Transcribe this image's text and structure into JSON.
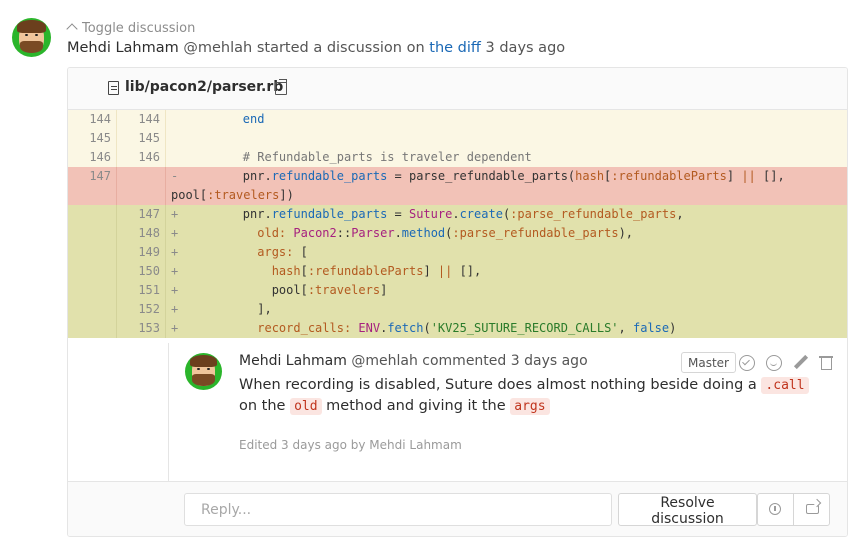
{
  "discussion": {
    "toggle_label": "Toggle discussion",
    "author_name": "Mehdi Lahmam",
    "author_handle": "@mehlah",
    "action_text": "started a discussion on",
    "diff_link": "the diff",
    "time_ago": "3 days ago"
  },
  "file": {
    "path": "lib/pacon2/parser.rb"
  },
  "diff_lines": [
    {
      "type": "ctx",
      "old": "144",
      "new": "144",
      "marker": "",
      "code": "        end"
    },
    {
      "type": "ctx",
      "old": "145",
      "new": "145",
      "marker": "",
      "code": ""
    },
    {
      "type": "ctx",
      "old": "146",
      "new": "146",
      "marker": "",
      "code": "        # Refundable_parts is traveler dependent"
    },
    {
      "type": "del",
      "old": "147",
      "new": "",
      "marker": "-",
      "code": "        pnr.refundable_parts = parse_refundable_parts(hash[:refundableParts] || [],\npool[:travelers])"
    },
    {
      "type": "add",
      "old": "",
      "new": "147",
      "marker": "+",
      "code": "        pnr.refundable_parts = Suture.create(:parse_refundable_parts,"
    },
    {
      "type": "add",
      "old": "",
      "new": "148",
      "marker": "+",
      "code": "          old: Pacon2::Parser.method(:parse_refundable_parts),"
    },
    {
      "type": "add",
      "old": "",
      "new": "149",
      "marker": "+",
      "code": "          args: ["
    },
    {
      "type": "add",
      "old": "",
      "new": "150",
      "marker": "+",
      "code": "            hash[:refundableParts] || [],"
    },
    {
      "type": "add",
      "old": "",
      "new": "151",
      "marker": "+",
      "code": "            pool[:travelers]"
    },
    {
      "type": "add",
      "old": "",
      "new": "152",
      "marker": "+",
      "code": "          ],"
    },
    {
      "type": "add",
      "old": "",
      "new": "153",
      "marker": "+",
      "code": "          record_calls: ENV.fetch('KV25_SUTURE_RECORD_CALLS', false)"
    }
  ],
  "note": {
    "author_name": "Mehdi Lahmam",
    "author_handle": "@mehlah",
    "action": "commented",
    "time_ago": "3 days ago",
    "role_badge": "Master",
    "body_part1": "When recording is disabled, Suture does almost nothing beside doing a ",
    "code1": ".call",
    "body_part2": " on the ",
    "code2": "old",
    "body_part3": " method and giving it the ",
    "code3": "args",
    "edited_text": "Edited 3 days ago by Mehdi Lahmam"
  },
  "reply": {
    "placeholder": "Reply...",
    "resolve_label": "Resolve discussion"
  },
  "colors": {
    "link": "#1b69b6",
    "context_bg": "#fbf7e4",
    "deleted_bg": "#f2c2b7",
    "added_bg": "#e1e1ac",
    "inline_code": "#c0341d",
    "avatar_bg": "#2bb52b"
  },
  "icons": {
    "toggle": "chevron-up-icon",
    "file": "file-icon",
    "copy": "clipboard-icon",
    "resolve": "check-circle-icon",
    "emoji": "smiley-icon",
    "edit": "pencil-icon",
    "delete": "trash-icon",
    "jump": "jump-to-discussion-icon",
    "next": "next-discussion-icon"
  }
}
